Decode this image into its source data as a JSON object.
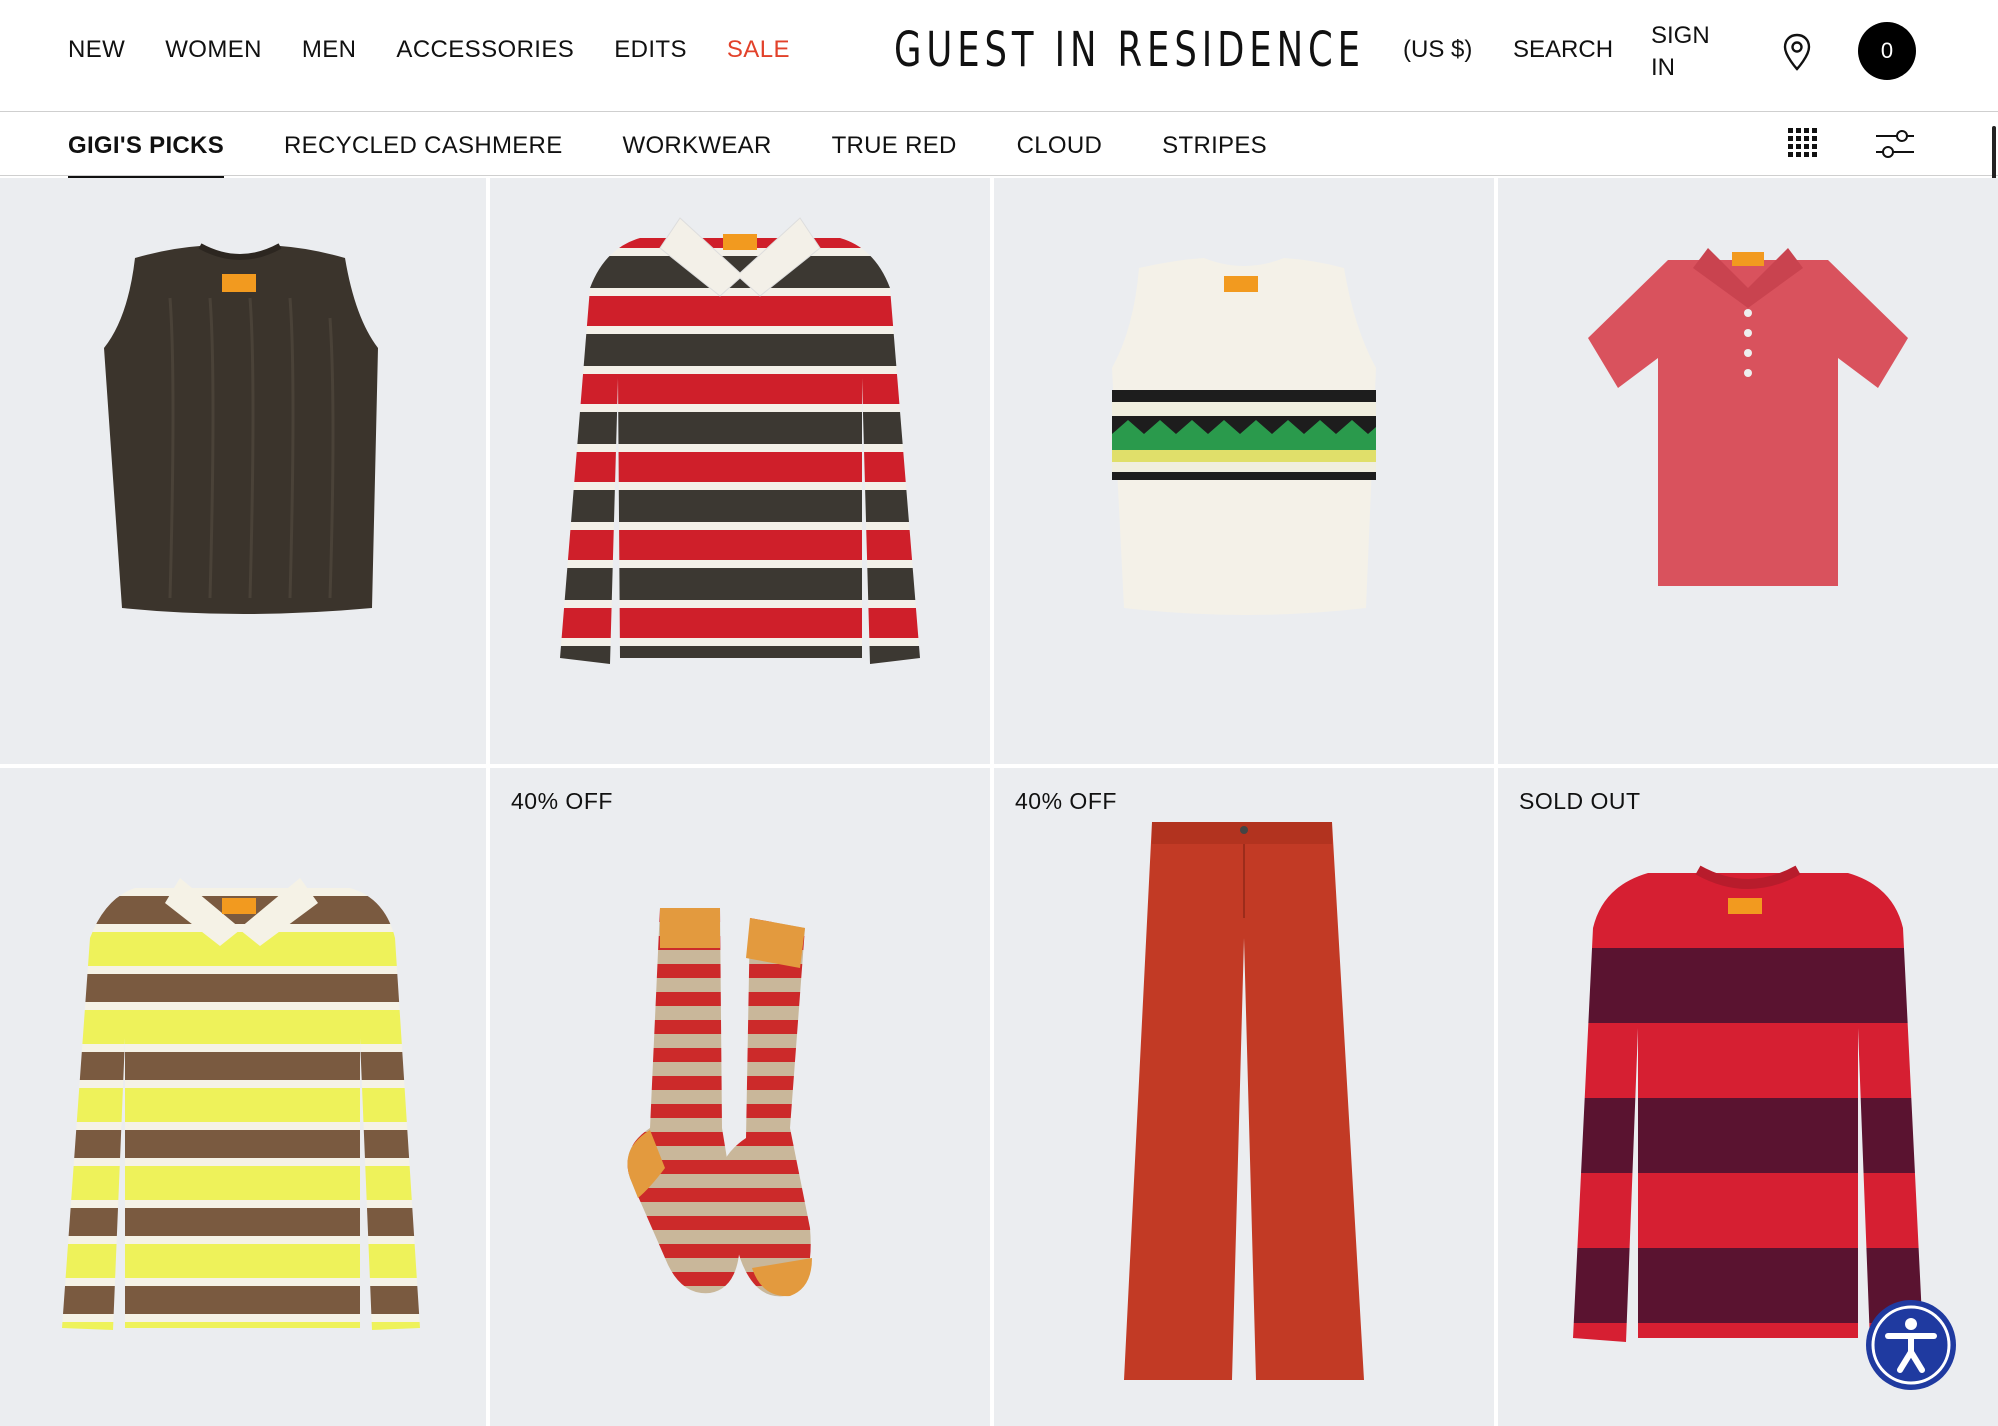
{
  "header": {
    "nav": [
      "NEW",
      "WOMEN",
      "MEN",
      "ACCESSORIES",
      "EDITS",
      "SALE"
    ],
    "logo": "GUEST IN RESIDENCE",
    "currency": "(US $)",
    "search": "SEARCH",
    "sign_in_line1": "SIGN",
    "sign_in_line2": "IN",
    "cart_count": "0",
    "sale_color": "#e2412a"
  },
  "subnav": {
    "items": [
      "GIGI'S PICKS",
      "RECYCLED CASHMERE",
      "WORKWEAR",
      "TRUE RED",
      "CLOUD",
      "STRIPES"
    ],
    "active": "GIGI'S PICKS"
  },
  "products": [
    {
      "badge": ""
    },
    {
      "badge": ""
    },
    {
      "badge": ""
    },
    {
      "badge": ""
    },
    {
      "badge": ""
    },
    {
      "badge": "40% OFF"
    },
    {
      "badge": "40% OFF"
    },
    {
      "badge": "SOLD OUT"
    }
  ],
  "icons": {
    "location": "location-pin-icon",
    "grid_view": "grid-view-icon",
    "filter": "filter-sliders-icon",
    "accessibility": "accessibility-icon"
  }
}
